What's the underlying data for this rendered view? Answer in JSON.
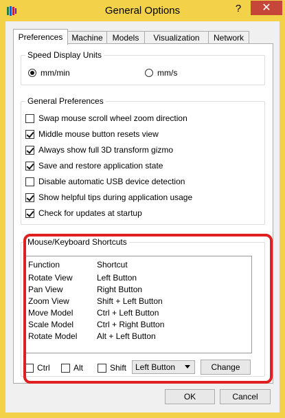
{
  "window": {
    "title": "General Options",
    "help_label": "?",
    "close_label": "✕"
  },
  "tabs": [
    {
      "label": "Preferences"
    },
    {
      "label": "Machine"
    },
    {
      "label": "Models"
    },
    {
      "label": "Visualization"
    },
    {
      "label": "Network"
    }
  ],
  "speed_units": {
    "title": "Speed Display Units",
    "options": [
      {
        "label": "mm/min",
        "selected": true
      },
      {
        "label": "mm/s",
        "selected": false
      }
    ]
  },
  "general_preferences": {
    "title": "General Preferences",
    "items": [
      {
        "label": "Swap mouse scroll wheel zoom direction",
        "checked": false
      },
      {
        "label": "Middle mouse button resets view",
        "checked": true
      },
      {
        "label": "Always show full 3D transform gizmo",
        "checked": true
      },
      {
        "label": "Save and restore application state",
        "checked": true
      },
      {
        "label": "Disable automatic USB device detection",
        "checked": false
      },
      {
        "label": "Show helpful tips during application usage",
        "checked": true
      },
      {
        "label": "Check for updates at startup",
        "checked": true
      }
    ]
  },
  "shortcuts": {
    "title": "Mouse/Keyboard Shortcuts",
    "columns": [
      "Function",
      "Shortcut"
    ],
    "rows": [
      [
        "Rotate View",
        "Left Button"
      ],
      [
        "Pan View",
        "Right Button"
      ],
      [
        "Zoom View",
        "Shift + Left Button"
      ],
      [
        "Move Model",
        "Ctrl + Left Button"
      ],
      [
        "Scale Model",
        "Ctrl + Right Button"
      ],
      [
        "Rotate Model",
        "Alt + Left Button"
      ]
    ],
    "modifiers": [
      {
        "label": "Ctrl",
        "checked": false
      },
      {
        "label": "Alt",
        "checked": false
      },
      {
        "label": "Shift",
        "checked": false
      }
    ],
    "button_select": "Left Button",
    "change_label": "Change"
  },
  "footer": {
    "ok_label": "OK",
    "cancel_label": "Cancel"
  },
  "colors": {
    "frame": "#f3d24a",
    "close": "#c7463a",
    "highlight": "#e02020"
  }
}
